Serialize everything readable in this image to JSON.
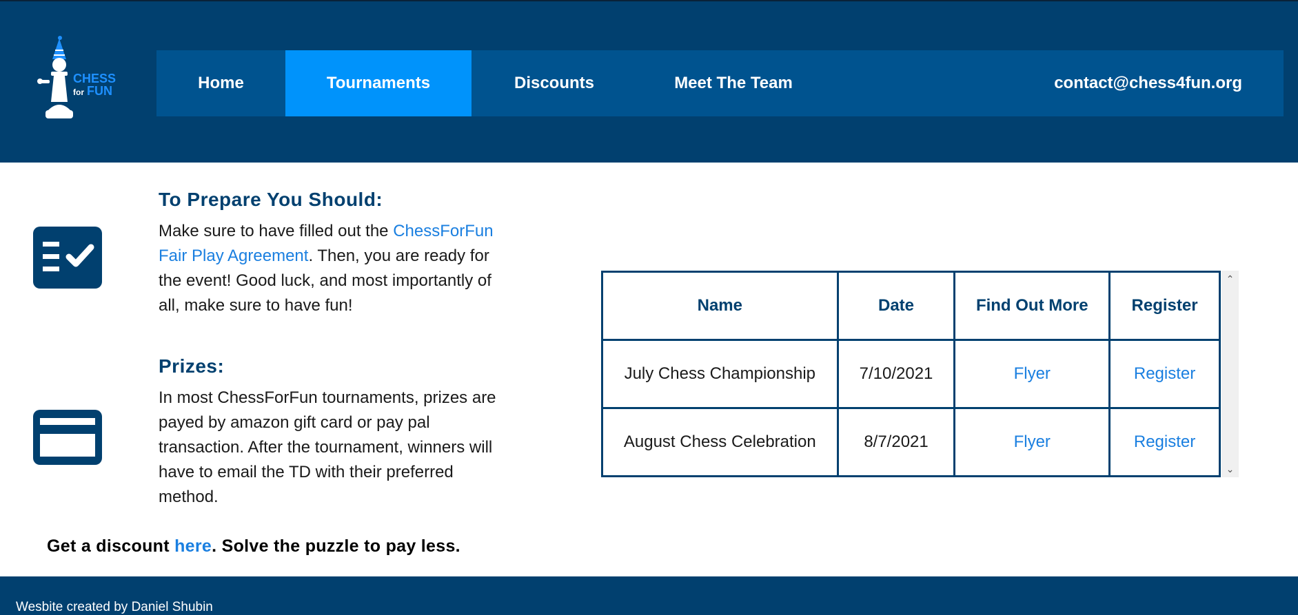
{
  "brand": {
    "logo_text_top": "CHESS",
    "logo_text_mid": "for",
    "logo_text_bottom": "FUN"
  },
  "nav": {
    "items": [
      {
        "label": "Home"
      },
      {
        "label": "Tournaments"
      },
      {
        "label": "Discounts"
      },
      {
        "label": "Meet The Team"
      }
    ],
    "active": "Tournaments",
    "contact": "contact@chess4fun.org"
  },
  "prepare": {
    "title": "To Prepare You Should:",
    "text_before": "Make sure to have filled out the ",
    "link": "ChessForFun Fair Play Agreement",
    "text_after": ". Then, you are ready for the event! Good luck, and most importantly of all, make sure to have fun!",
    "icon": "checklist-icon"
  },
  "prizes": {
    "title": "Prizes:",
    "text": "In most ChessForFun tournaments, prizes are payed by amazon gift card or pay pal transaction. After the tournament, winners will have to email the TD with their preferred method.",
    "icon": "credit-card-icon"
  },
  "discount": {
    "text_before": "Get a discount ",
    "link": "here",
    "text_after": ". Solve the puzzle to pay less."
  },
  "table": {
    "headers": [
      "Name",
      "Date",
      "Find Out More",
      "Register"
    ],
    "rows": [
      {
        "name": "July Chess Championship",
        "date": "7/10/2021",
        "more": "Flyer",
        "register": "Register"
      },
      {
        "name": "August Chess Celebration",
        "date": "8/7/2021",
        "more": "Flyer",
        "register": "Register"
      }
    ]
  },
  "footer": {
    "text": "Wesbite created by Daniel Shubin"
  },
  "colors": {
    "header_bg": "#01406f",
    "nav_bg": "#00538f",
    "nav_active": "#0093fb",
    "link": "#1a7fe0",
    "logo_blue": "#1e90ff"
  }
}
